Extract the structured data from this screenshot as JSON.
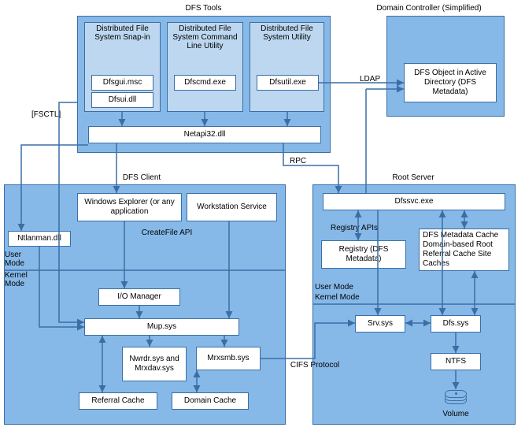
{
  "titles": {
    "dfs_tools": "DFS Tools",
    "domain_controller": "Domain Controller (Simplified)",
    "dfs_client": "DFS Client",
    "root_server": "Root Server"
  },
  "tools": {
    "snap_in": "Distributed File System Snap-in",
    "cmd_util": "Distributed File System Command Line Utility",
    "sys_util": "Distributed File System Utility",
    "dfsgui": "Dfsgui.msc",
    "dfsui": "Dfsui.dll",
    "dfscmd": "Dfscmd.exe",
    "dfsutil": "Dfsutil.exe",
    "netapi": "Netapi32.dll"
  },
  "dc": {
    "dfs_object": "DFS Object in Active Directory (DFS Metadata)"
  },
  "client": {
    "explorer": "Windows Explorer (or any application",
    "ws_service": "Workstation Service",
    "ntlanman": "Ntlanman.dll",
    "createfile": "CreateFile API",
    "iomgr": "I/O Manager",
    "mup": "Mup.sys",
    "nwrdr": "Nwrdr.sys and Mrxdav.sys",
    "mrxsmb": "Mrxsmb.sys",
    "referral": "Referral Cache",
    "domain_cache": "Domain Cache"
  },
  "root": {
    "dfssvc": "Dfssvc.exe",
    "registry_apis": "Registry APIs",
    "registry": "Registry (DFS Metadata)",
    "metadata_cache": "DFS Metadata Cache Domain-based Root Referral Cache Site Caches",
    "srv": "Srv.sys",
    "dfssys": "Dfs.sys",
    "ntfs": "NTFS",
    "volume": "Volume"
  },
  "labels": {
    "fsctl": "[FSCTL]",
    "ldap": "LDAP",
    "rpc": "RPC",
    "user_mode1": "User Mode",
    "kernel_mode1": "Kernel Mode",
    "user_mode2": "User Mode",
    "kernel_mode2": "Kernel Mode",
    "cifs": "CIFS Protocol"
  }
}
